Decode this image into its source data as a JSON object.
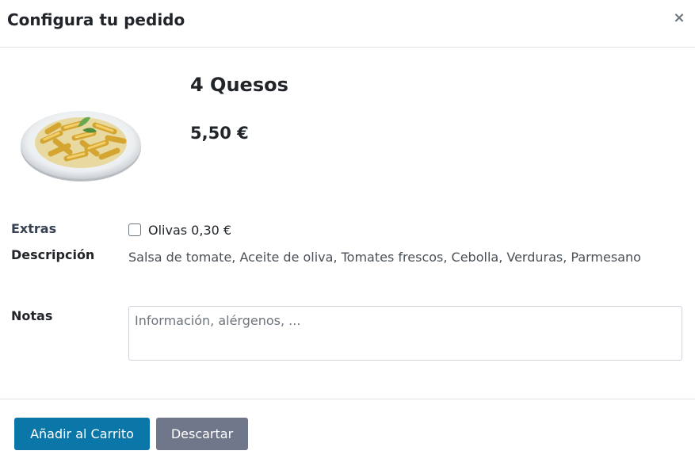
{
  "dialog": {
    "title": "Configura tu pedido",
    "close_glyph": "×"
  },
  "product": {
    "name": "4 Quesos",
    "price": "5,50 €",
    "image_icon": "pasta-plate-image"
  },
  "form": {
    "extras_label": "Extras",
    "extras": [
      {
        "label": "Olivas 0,30 €",
        "checked": false
      }
    ],
    "description_label": "Descripción",
    "description_text": "Salsa de tomate, Aceite de oliva, Tomates frescos, Cebolla, Verduras, Parmesano",
    "notes_label": "Notas",
    "notes_placeholder": "Información, alérgenos, ...",
    "notes_value": ""
  },
  "footer": {
    "add_label": "Añadir al Carrito",
    "discard_label": "Descartar"
  },
  "colors": {
    "primary": "#0b77a8",
    "secondary": "#71778a"
  }
}
